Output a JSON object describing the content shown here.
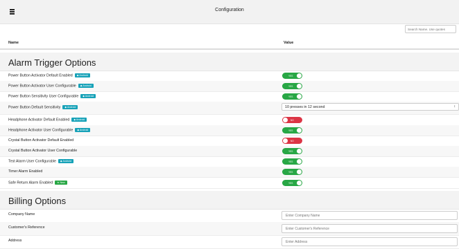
{
  "header": {
    "title": "Configuration"
  },
  "search": {
    "placeholder": "Search Name. Use quotes"
  },
  "columns": {
    "name": "Name",
    "value": "Value"
  },
  "sections": {
    "alarm": "Alarm Trigger Options",
    "billing": "Billing Options"
  },
  "rows": [
    {
      "label": "Power Button Activator Default Enabled",
      "badge": "Android",
      "value": "YES"
    },
    {
      "label": "Power Button Activator User Configurable",
      "badge": "Android",
      "value": "YES"
    },
    {
      "label": "Power Button Sensitivity User Configurable",
      "badge": "Android",
      "value": "YES"
    },
    {
      "label": "Power Button Default Sensitivity",
      "badge": "Android",
      "value": "10 presses in 12 second"
    },
    {
      "label": "Headphone Activator Default Enabled",
      "badge": "Android",
      "value": "NO"
    },
    {
      "label": "Headphone Activator User Configurable",
      "badge": "Android",
      "value": "YES"
    },
    {
      "label": "Crystal Button Activator Default Enabled",
      "value": "NO"
    },
    {
      "label": "Crystal Button Activator User Configurable",
      "value": "YES"
    },
    {
      "label": "Test Alarm User Configurable",
      "badge": "Android",
      "value": "YES"
    },
    {
      "label": "Timer Alarm Enabled",
      "value": "YES"
    },
    {
      "label": "Safe Return Alarm Enabled",
      "badge": "New",
      "value": "YES"
    }
  ],
  "billing": [
    {
      "label": "Company Name",
      "placeholder": "Enter Company Name"
    },
    {
      "label": "Customer's Reference",
      "placeholder": "Enter Customer's Reference"
    },
    {
      "label": "Address",
      "placeholder": "Enter Address"
    }
  ],
  "colors": {
    "on": "#28a745",
    "off": "#dc3545",
    "badge_android": "#17a2b8",
    "badge_new": "#28a745"
  },
  "icons": {
    "menu": "hamburger-menu-icon",
    "android": "android-icon",
    "new": "new-icon",
    "select_arrow": "select-arrows-icon"
  }
}
